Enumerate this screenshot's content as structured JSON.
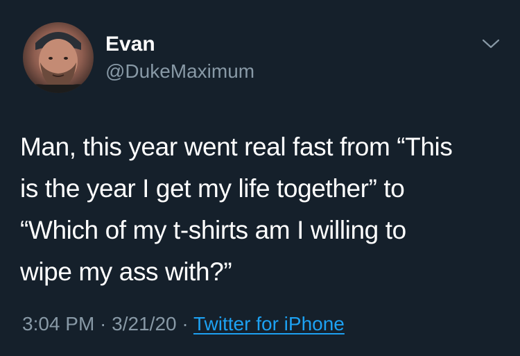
{
  "author": {
    "name": "Evan",
    "handle": "@DukeMaximum"
  },
  "tweet": {
    "lines": [
      "Man, this year went real fast from “This",
      "is the year I get my life together” to",
      "“Which of my t-shirts am I willing to",
      "wipe my ass with?”"
    ]
  },
  "meta": {
    "time": "3:04 PM",
    "separator": " · ",
    "date": "3/21/20",
    "source": "Twitter for iPhone"
  },
  "icons": {
    "menu": "chevron-down-icon"
  },
  "colors": {
    "background": "#15202b",
    "primary_text": "#ffffff",
    "secondary_text": "#8899a6",
    "link": "#1da1f2"
  }
}
